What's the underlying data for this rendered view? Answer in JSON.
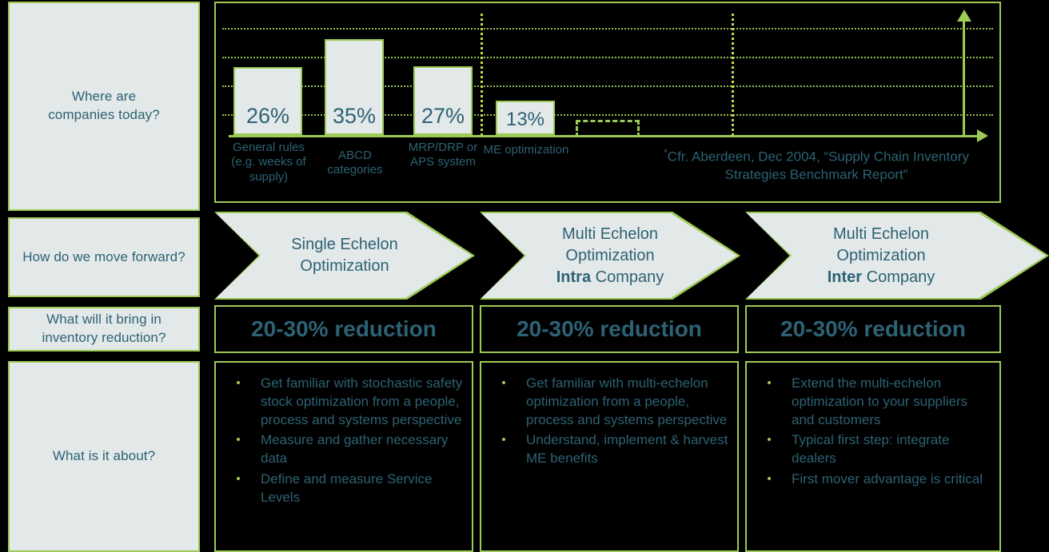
{
  "sidebar": {
    "items": [
      {
        "id": "where-are-companies-today",
        "label": "Where are\ncompanies today?"
      },
      {
        "id": "how-do-we-move-forward",
        "label": "How do we move forward?"
      },
      {
        "id": "what-will-it-bring",
        "label": "What will it bring in\ninventory reduction?"
      },
      {
        "id": "what-is-it-about",
        "label": "What is it about?"
      }
    ]
  },
  "chart_data": {
    "type": "bar",
    "title": "",
    "xlabel": "",
    "ylabel": "",
    "categories": [
      "General rules\n(e.g. weeks of\nsupply)",
      "ABCD\ncategories",
      "MRP/DRP\nor APS\nsystem",
      "ME\noptimization"
    ],
    "values": [
      26,
      35,
      27,
      13
    ],
    "value_labels": [
      "26%",
      "35%",
      "27%",
      "13%"
    ],
    "ylim": [
      0,
      50
    ],
    "gridlines": [
      10,
      20,
      30,
      40
    ],
    "grid": true,
    "legend": null,
    "annotations": [
      {
        "type": "dashed-placeholder-box",
        "after_category": "ME optimization"
      },
      {
        "type": "vertical-dotted-divider",
        "between": "ME optimization / future"
      },
      {
        "type": "up-arrow",
        "note": "growth arrow at right"
      }
    ],
    "source_note": "Cfr. Aberdeen, Dec 2004, “Supply Chain Inventory Strategies Benchmark Report”",
    "source_note_marker": "*"
  },
  "stages": [
    {
      "line1": "Single Echelon",
      "line2": "Optimization",
      "line3_bold": "",
      "line3_rest": ""
    },
    {
      "line1": "Multi Echelon",
      "line2": "Optimization",
      "line3_bold": "Intra",
      "line3_rest": " Company"
    },
    {
      "line1": "Multi Echelon",
      "line2": "Optimization",
      "line3_bold": "Inter",
      "line3_rest": " Company"
    }
  ],
  "reductions": [
    {
      "text": "20-30% reduction"
    },
    {
      "text": "20-30% reduction"
    },
    {
      "text": "20-30% reduction"
    }
  ],
  "bullet_columns": [
    {
      "items": [
        "Get familiar with stochastic safety stock optimization from a people, process and systems perspective",
        "Measure and gather necessary data",
        "Define and measure Service Levels"
      ]
    },
    {
      "items": [
        "Get familiar with multi-echelon optimization from a people, process and systems perspective",
        "Understand, implement & harvest ME benefits"
      ]
    },
    {
      "items": [
        "Extend the multi-echelon optimization to your suppliers and customers",
        "Typical first step: integrate dealers",
        "First mover advantage is critical"
      ]
    }
  ],
  "colors": {
    "background": "#000000",
    "accent_green": "#9ccb55",
    "panel_fill": "#e3e8e9",
    "text_teal": "#2d6274",
    "dotted_yellow_green": "#c9d94b"
  }
}
